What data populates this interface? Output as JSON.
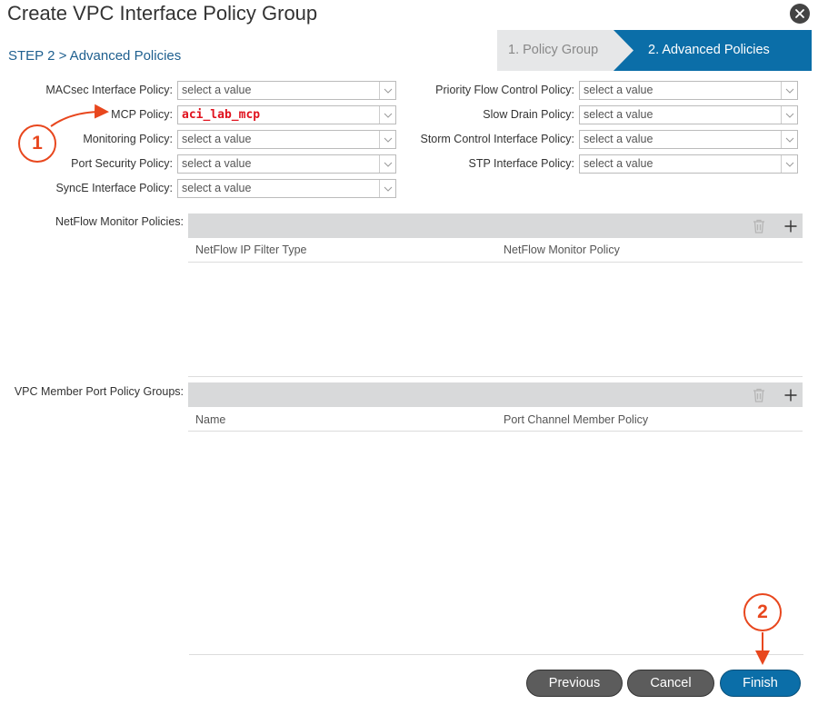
{
  "dialog": {
    "title": "Create VPC Interface Policy Group",
    "step_label": "STEP 2 > Advanced Policies"
  },
  "wizard": {
    "steps": [
      {
        "label": "1. Policy Group",
        "active": false
      },
      {
        "label": "2. Advanced Policies",
        "active": true
      }
    ]
  },
  "left_fields": [
    {
      "label": "MACsec Interface Policy:",
      "value": "select a value"
    },
    {
      "label": "MCP Policy:",
      "value": "aci_lab_mcp"
    },
    {
      "label": "Monitoring Policy:",
      "value": "select a value"
    },
    {
      "label": "Port Security Policy:",
      "value": "select a value"
    },
    {
      "label": "SyncE Interface Policy:",
      "value": "select a value"
    }
  ],
  "right_fields": [
    {
      "label": "Priority Flow Control Policy:",
      "value": "select a value"
    },
    {
      "label": "Slow Drain Policy:",
      "value": "select a value"
    },
    {
      "label": "Storm Control Interface Policy:",
      "value": "select a value"
    },
    {
      "label": "STP Interface Policy:",
      "value": "select a value"
    }
  ],
  "netflow": {
    "label": "NetFlow Monitor Policies:",
    "columns": [
      "NetFlow IP Filter Type",
      "NetFlow Monitor Policy"
    ]
  },
  "vpc_member": {
    "label": "VPC Member Port Policy Groups:",
    "columns": [
      "Name",
      "Port Channel Member Policy"
    ]
  },
  "footer": {
    "previous_label": "Previous",
    "cancel_label": "Cancel",
    "finish_label": "Finish"
  },
  "annotations": {
    "callout_1": "1",
    "callout_2": "2",
    "color": "#e8471e"
  },
  "colors": {
    "accent": "#0b6ea8",
    "title_link": "#1e5f8f",
    "selected_value": "#e0121e"
  }
}
